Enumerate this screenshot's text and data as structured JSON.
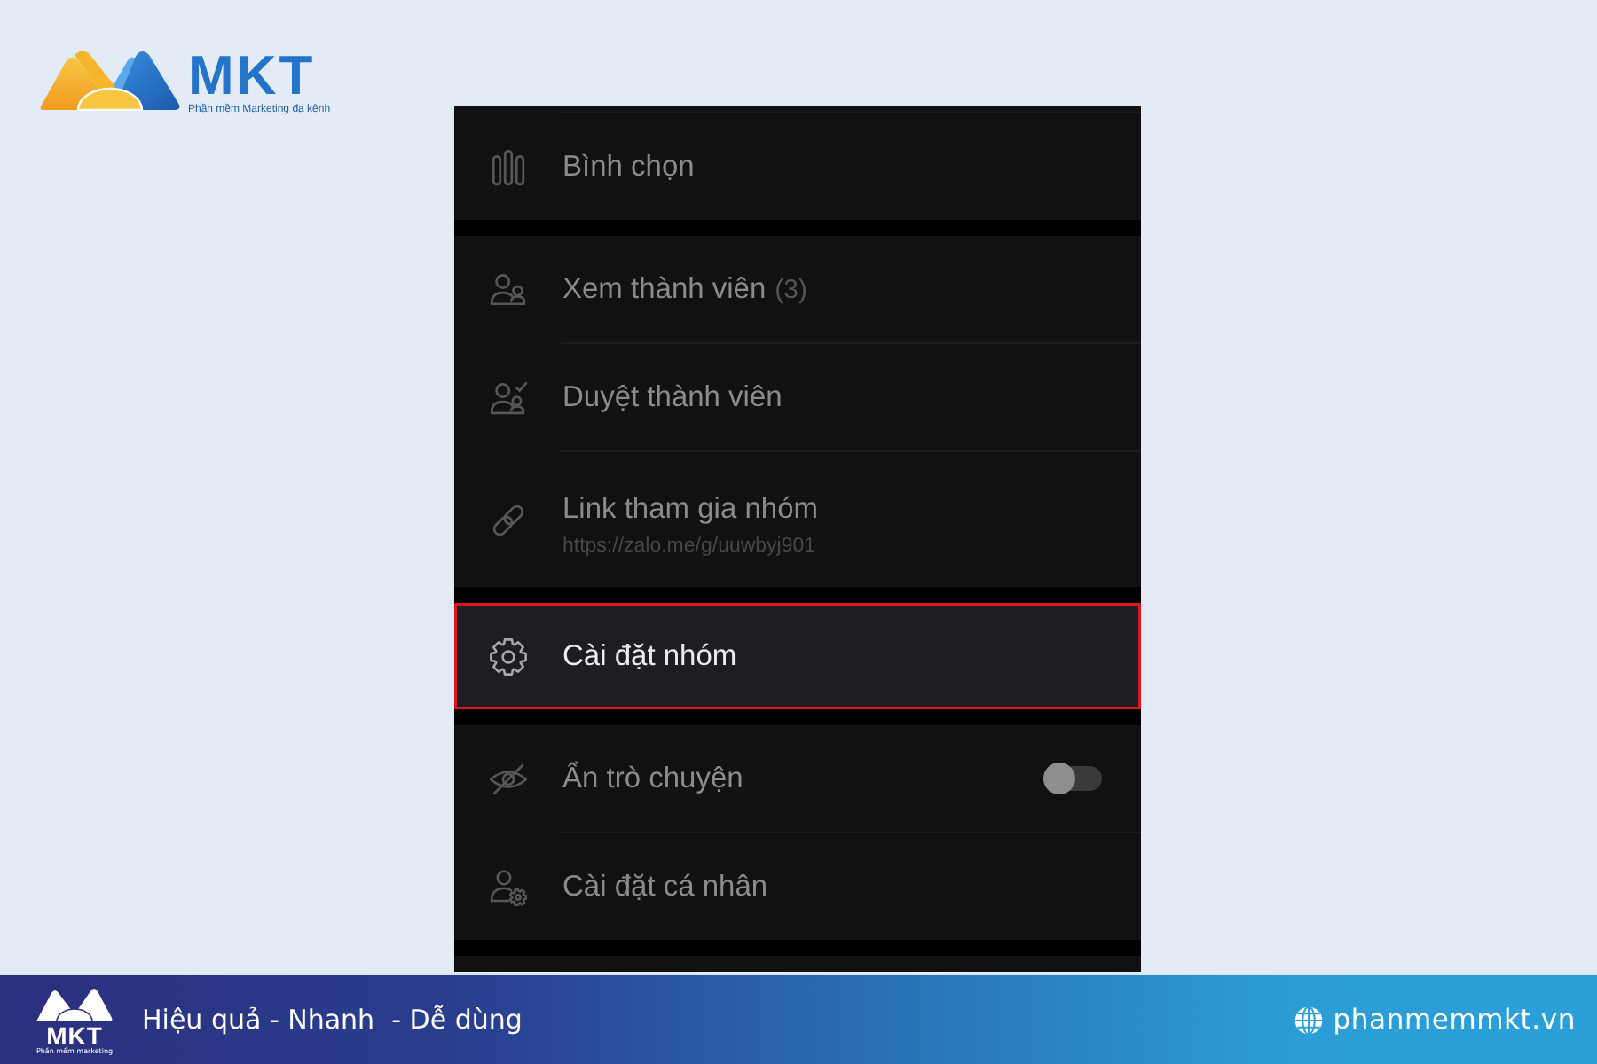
{
  "logo": {
    "name": "MKT",
    "tagline": "Phần mềm Marketing đa kênh"
  },
  "panel": {
    "sections": [
      {
        "items": [
          {
            "kind": "nav",
            "label": "Bình chọn",
            "selected": false
          }
        ]
      },
      {
        "items": [
          {
            "kind": "nav",
            "label": "Xem thành viên",
            "count": "(3)",
            "selected": false
          },
          {
            "kind": "nav",
            "label": "Duyệt thành viên",
            "selected": false
          },
          {
            "kind": "nav",
            "label": "Link tham gia nhóm",
            "subtitle": "https://zalo.me/g/uuwbyj901",
            "selected": false
          }
        ]
      },
      {
        "items": [
          {
            "kind": "nav",
            "label": "Cài đặt nhóm",
            "selected": true
          }
        ]
      },
      {
        "items": [
          {
            "kind": "toggle",
            "label": "Ẩn trò chuyện",
            "on": false,
            "selected": false
          },
          {
            "kind": "nav",
            "label": "Cài đặt cá nhân",
            "selected": false
          }
        ]
      }
    ]
  },
  "banner": {
    "logo_name": "MKT",
    "logo_tagline": "Phần mềm marketing",
    "slogan": "Hiệu quả - Nhanh  - Dễ dùng",
    "website": "phanmemmkt.vn"
  }
}
